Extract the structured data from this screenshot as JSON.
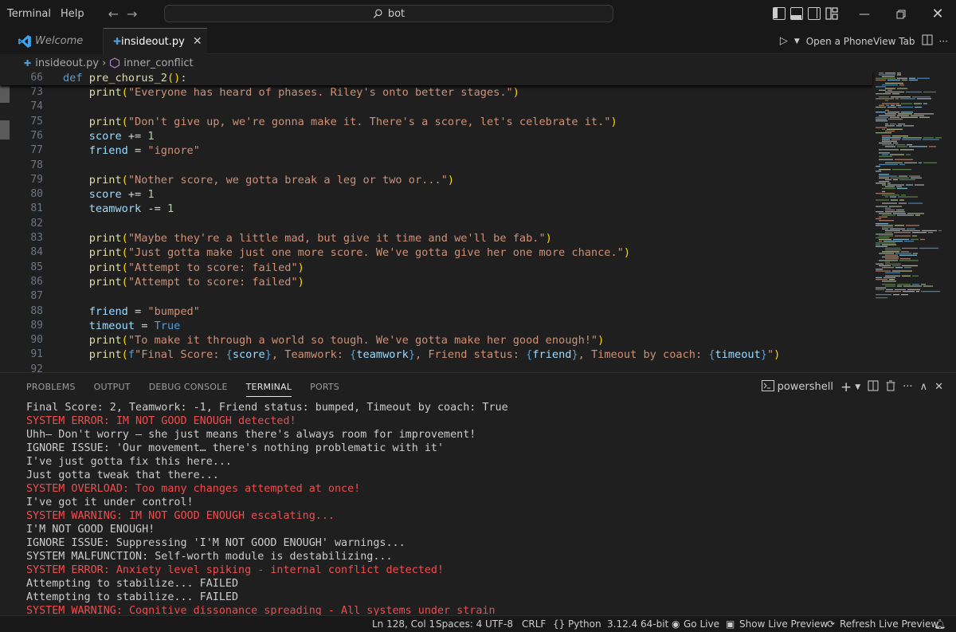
{
  "titlebar": {
    "menu": [
      "Terminal",
      "Help"
    ],
    "search_text": "bot"
  },
  "tabs": [
    {
      "label": "Welcome"
    },
    {
      "label": "insideout.py"
    }
  ],
  "editor_actions": {
    "phoneview_label": "Open a PhoneView Tab"
  },
  "breadcrumb": {
    "file": "insideout.py",
    "symbol": "inner_conflict"
  },
  "editor": {
    "sticky_line": {
      "number": "66",
      "code": "def pre_chorus_2():"
    },
    "lines": [
      {
        "number": "73",
        "code": "    print(\"Everyone has heard of phases. Riley's onto better stages.\")"
      },
      {
        "number": "74",
        "code": ""
      },
      {
        "number": "75",
        "code": "    print(\"Don't give up, we're gonna make it. There's a score, let's celebrate it.\")"
      },
      {
        "number": "76",
        "code": "    score += 1"
      },
      {
        "number": "77",
        "code": "    friend = \"ignore\""
      },
      {
        "number": "78",
        "code": ""
      },
      {
        "number": "79",
        "code": "    print(\"Nother score, we gotta break a leg or two or...\")"
      },
      {
        "number": "80",
        "code": "    score += 1"
      },
      {
        "number": "81",
        "code": "    teamwork -= 1"
      },
      {
        "number": "82",
        "code": ""
      },
      {
        "number": "83",
        "code": "    print(\"Maybe they're a little mad, but give it time and we'll be fab.\")"
      },
      {
        "number": "84",
        "code": "    print(\"Just gotta make just one more score. We've gotta give her one more chance.\")"
      },
      {
        "number": "85",
        "code": "    print(\"Attempt to score: failed\")"
      },
      {
        "number": "86",
        "code": "    print(\"Attempt to score: failed\")"
      },
      {
        "number": "87",
        "code": ""
      },
      {
        "number": "88",
        "code": "    friend = \"bumped\""
      },
      {
        "number": "89",
        "code": "    timeout = True"
      },
      {
        "number": "90",
        "code": "    print(\"To make it through a world so tough. We've gotta make her good enough!\")"
      },
      {
        "number": "91",
        "code": "    print(f\"Final Score: {score}, Teamwork: {teamwork}, Friend status: {friend}, Timeout by coach: {timeout}\")"
      },
      {
        "number": "92",
        "code": ""
      }
    ]
  },
  "panel": {
    "tabs": [
      "PROBLEMS",
      "OUTPUT",
      "DEBUG CONSOLE",
      "TERMINAL",
      "PORTS"
    ],
    "active_tab": "TERMINAL",
    "shell_label": "powershell",
    "terminal_lines": [
      {
        "text": "Final Score: 2, Teamwork: -1, Friend status: bumped, Timeout by coach: True",
        "type": "normal"
      },
      {
        "text": "SYSTEM ERROR: IM NOT GOOD ENOUGH detected!",
        "type": "error"
      },
      {
        "text": "Uhh— Don't worry — she just means there's always room for improvement!",
        "type": "normal"
      },
      {
        "text": "IGNORE ISSUE: 'Our movement… there's nothing problematic with it'",
        "type": "normal"
      },
      {
        "text": "I've just gotta fix this here...",
        "type": "normal"
      },
      {
        "text": "Just gotta tweak that there...",
        "type": "normal"
      },
      {
        "text": "SYSTEM OVERLOAD: Too many changes attempted at once!",
        "type": "error"
      },
      {
        "text": "I've got it under control!",
        "type": "normal"
      },
      {
        "text": "SYSTEM WARNING: IM NOT GOOD ENOUGH escalating...",
        "type": "error"
      },
      {
        "text": "I'M NOT GOOD ENOUGH!",
        "type": "normal"
      },
      {
        "text": "IGNORE ISSUE: Suppressing 'I'M NOT GOOD ENOUGH' warnings...",
        "type": "normal"
      },
      {
        "text": "SYSTEM MALFUNCTION: Self-worth module is destabilizing...",
        "type": "normal"
      },
      {
        "text": "SYSTEM ERROR: Anxiety level spiking - internal conflict detected!",
        "type": "error"
      },
      {
        "text": "Attempting to stabilize... FAILED",
        "type": "normal"
      },
      {
        "text": "Attempting to stabilize... FAILED",
        "type": "normal"
      },
      {
        "text": "SYSTEM WARNING: Cognitive dissonance spreading - All systems under strain",
        "type": "error"
      }
    ]
  },
  "statusbar": {
    "position": "Ln 128, Col 1",
    "spaces": "Spaces: 4",
    "encoding": "UTF-8",
    "eol": "CRLF",
    "language": "Python",
    "interpreter": "3.12.4 64-bit",
    "go_live": "Go Live",
    "show_preview": "Show Live Preview",
    "refresh_preview": "Refresh Live Preview"
  },
  "colors": {
    "accent": "#0078d4",
    "error_text": "#f14c4c",
    "string": "#ce9178",
    "keyword": "#569cd6",
    "function": "#dcdcaa",
    "variable": "#9cdcfe",
    "number": "#b5cea8"
  }
}
